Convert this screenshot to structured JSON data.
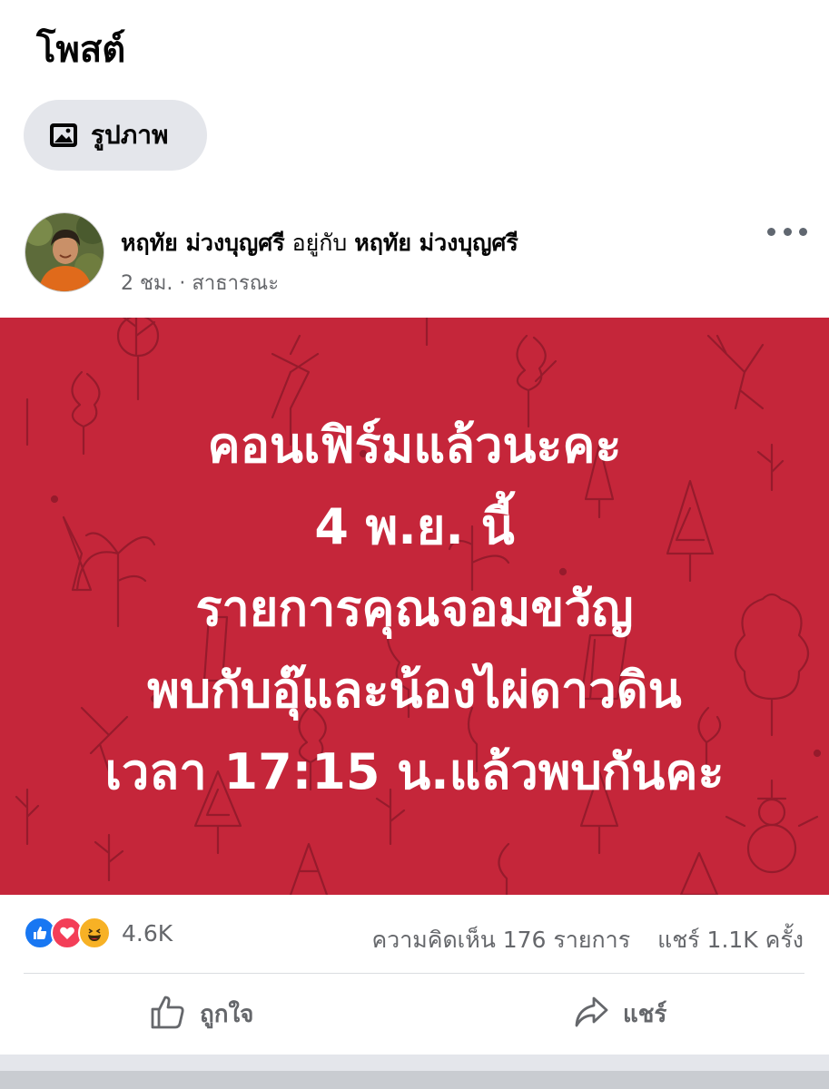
{
  "page": {
    "title": "โพสต์"
  },
  "chip": {
    "label": "รูปภาพ",
    "icon": "photo-icon"
  },
  "post": {
    "author": "หฤทัย ม่วงบุญศรี",
    "with_text": "อยู่กับ",
    "tagged": "หฤทัย ม่วงบุญศรี",
    "time": "2 ชม.",
    "separator": "·",
    "privacy": "สาธารณะ",
    "image_bg": "#c5263a",
    "image_lines": [
      "คอนเฟิร์มแล้วนะคะ",
      "4 พ.ย. นี้",
      "รายการคุณจอมขวัญ",
      "พบกับอุ๊และน้องไผ่ดาวดิน",
      "เวลา 17:15 น.แล้วพบกันคะ"
    ]
  },
  "stats": {
    "reactions": [
      "like-icon",
      "love-icon",
      "haha-icon"
    ],
    "reaction_count": "4.6K",
    "comments": "ความคิดเห็น 176 รายการ",
    "shares": "แชร์ 1.1K ครั้ง"
  },
  "actions": {
    "like_label": "ถูกใจ",
    "share_label": "แชร์"
  },
  "colors": {
    "accent": "#1877f2",
    "muted": "#65676b"
  }
}
